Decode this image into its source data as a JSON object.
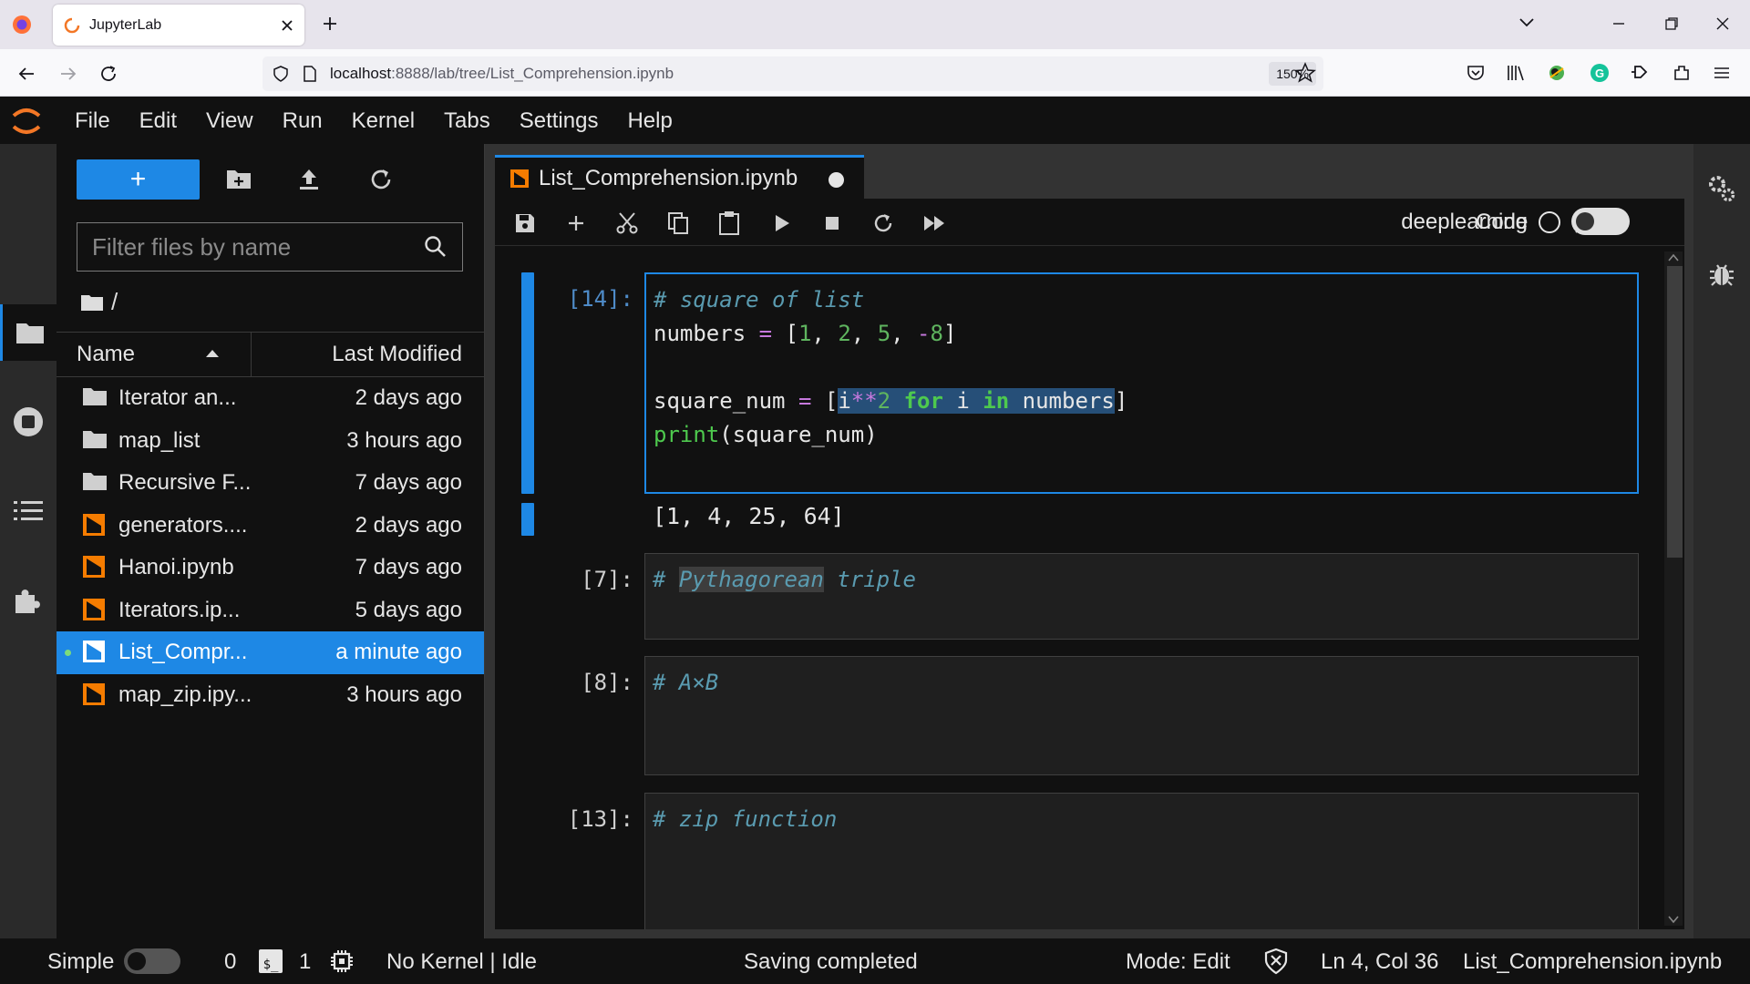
{
  "browser": {
    "tab_title": "JupyterLab",
    "url_host": "localhost",
    "url_path": ":8888/lab/tree/List_Comprehension.ipynb",
    "zoom": "150%"
  },
  "menubar": {
    "items": [
      "File",
      "Edit",
      "View",
      "Run",
      "Kernel",
      "Tabs",
      "Settings",
      "Help"
    ]
  },
  "filebrowser": {
    "new_button": "+",
    "filter_placeholder": "Filter files by name",
    "breadcrumb": "/",
    "columns": {
      "name": "Name",
      "modified": "Last Modified"
    },
    "files": [
      {
        "name": "Iterator an...",
        "modified": "2 days ago",
        "icon": "folder-icon"
      },
      {
        "name": "map_list",
        "modified": "3 hours ago",
        "icon": "folder-icon"
      },
      {
        "name": "Recursive F...",
        "modified": "7 days ago",
        "icon": "folder-icon"
      },
      {
        "name": "generators....",
        "modified": "2 days ago",
        "icon": "notebook-icon"
      },
      {
        "name": "Hanoi.ipynb",
        "modified": "7 days ago",
        "icon": "notebook-icon"
      },
      {
        "name": "Iterators.ip...",
        "modified": "5 days ago",
        "icon": "notebook-icon"
      },
      {
        "name": "List_Compr...",
        "modified": "a minute ago",
        "icon": "notebook-icon",
        "selected": true,
        "running": true
      },
      {
        "name": "map_zip.ipy...",
        "modified": "3 hours ago",
        "icon": "notebook-icon"
      }
    ]
  },
  "notebook": {
    "tab_title": "List_Comprehension.ipynb",
    "cell_type": "Code",
    "kernel_name": "deeplearning",
    "cells": [
      {
        "prompt": "[14]:",
        "lines": [
          "# square of list",
          "numbers = [1, 2, 5, -8]",
          "",
          "square_num = [i**2 for i in numbers]",
          "print(square_num)"
        ],
        "output": "[1, 4, 25, 64]"
      },
      {
        "prompt": "[7]:",
        "lines": [
          "# Pythagorean triple"
        ]
      },
      {
        "prompt": "[8]:",
        "lines": [
          "# A×B"
        ]
      },
      {
        "prompt": "[13]:",
        "lines": [
          "# zip function"
        ]
      }
    ]
  },
  "statusbar": {
    "mode_label": "Simple",
    "terminals_count": "0",
    "kernels_count": "1",
    "kernel_status": "No Kernel | Idle",
    "saving": "Saving completed",
    "mode": "Mode: Edit",
    "cursor": "Ln 4, Col 36",
    "filename": "List_Comprehension.ipynb"
  },
  "colors": {
    "accent": "#1e88e5",
    "notebook_orange": "#f57c00",
    "background": "#111111"
  }
}
